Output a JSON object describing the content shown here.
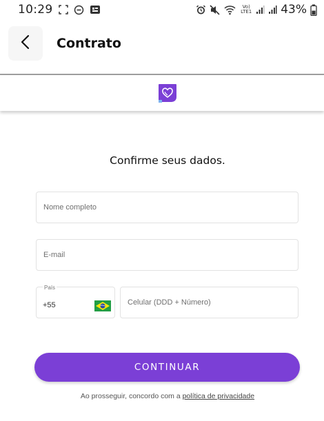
{
  "status_bar": {
    "time": "10:29",
    "battery_percent": "43%",
    "network_label": "Vo) LTE1"
  },
  "header": {
    "title": "Contrato",
    "back_icon": "chevron-left-icon"
  },
  "brand": {
    "logo_icon": "heart-shield-logo",
    "accent_color": "#7b3fd6"
  },
  "form": {
    "heading": "Confirme seus dados.",
    "name_placeholder": "Nome completo",
    "email_placeholder": "E-mail",
    "country_label": "País",
    "country_code": "+55",
    "country_flag": "brazil-flag-icon",
    "phone_placeholder": "Celular (DDD + Número)"
  },
  "cta": {
    "label": "CONTINUAR"
  },
  "consent": {
    "text": "Ao prosseguir, concordo com a",
    "link": "política de privacidade"
  }
}
